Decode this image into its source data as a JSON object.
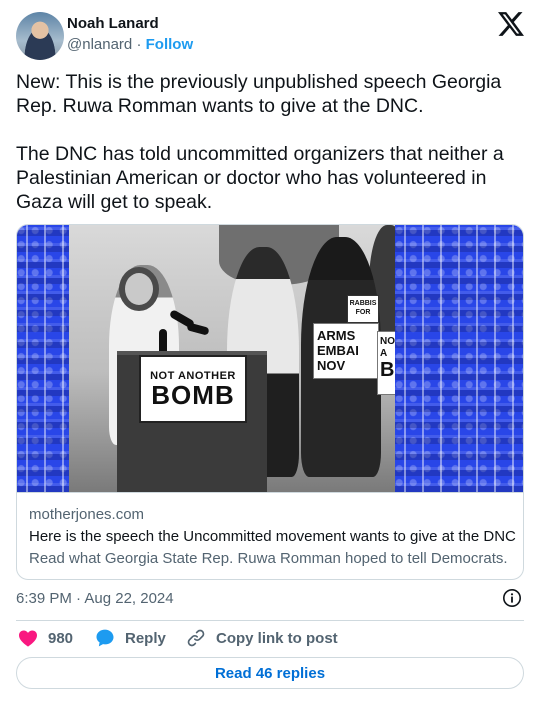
{
  "author": {
    "name": "Noah Lanard",
    "handle": "@nlanard",
    "separator": "·",
    "follow_label": "Follow"
  },
  "tweet": {
    "paragraph_1": "New: This is the previously unpublished speech Georgia Rep. Ruwa Romman wants to give at the DNC.",
    "paragraph_2": "The DNC has told uncommitted organizers that neither a Palestinian American or doctor who has volunteered in Gaza will get to speak."
  },
  "link_card": {
    "image_signs": {
      "podium_line1": "NOT ANOTHER",
      "podium_line2": "BOMB",
      "arms_line1": "ARMS",
      "arms_line2": "EMBAI",
      "arms_line3": "NOV",
      "nota_line1": "NOT A",
      "nota_line2": "B",
      "rabbis": "RABBIS FOR"
    },
    "domain": "motherjones.com",
    "title": "Here is the speech the Uncommitted movement wants to give at the DNC",
    "description": "Read what Georgia State Rep. Ruwa Romman hoped to tell Democrats."
  },
  "timestamp": "6:39 PM · Aug 22, 2024",
  "actions": {
    "like_count": "980",
    "reply_label": "Reply",
    "copy_label": "Copy link to post"
  },
  "read_replies_label": "Read 46 replies",
  "icons": {
    "brand": "x-logo-icon",
    "like": "heart-icon",
    "reply": "speech-bubble-icon",
    "copy": "link-icon",
    "info": "info-icon"
  },
  "colors": {
    "like": "#f91880",
    "reply": "#1d9bf0",
    "follow": "#1d9bf0",
    "read_replies": "#006fd6",
    "photo_panels": "#2946e8"
  }
}
